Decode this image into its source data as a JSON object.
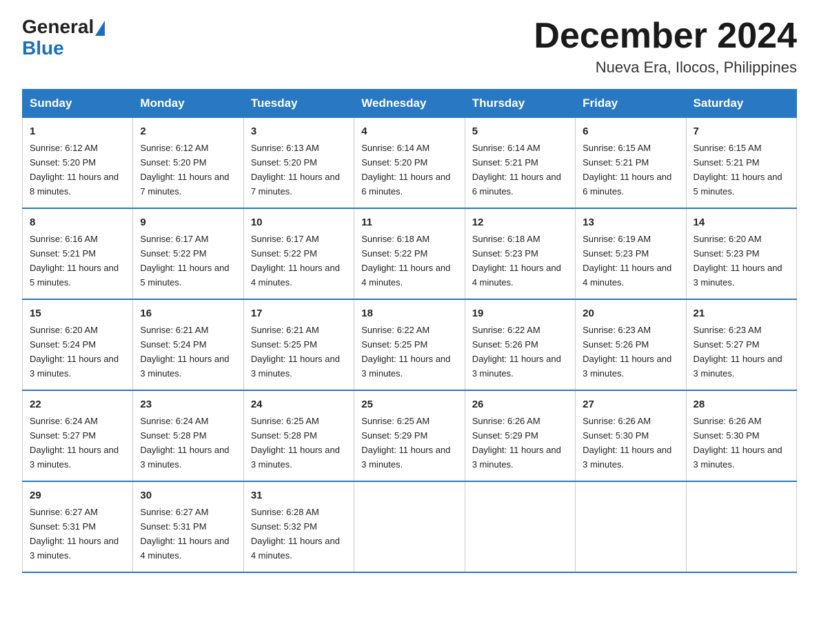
{
  "header": {
    "title": "December 2024",
    "subtitle": "Nueva Era, Ilocos, Philippines",
    "logo_general": "General",
    "logo_blue": "Blue"
  },
  "days_of_week": [
    "Sunday",
    "Monday",
    "Tuesday",
    "Wednesday",
    "Thursday",
    "Friday",
    "Saturday"
  ],
  "weeks": [
    [
      {
        "day": "1",
        "sunrise": "Sunrise: 6:12 AM",
        "sunset": "Sunset: 5:20 PM",
        "daylight": "Daylight: 11 hours and 8 minutes."
      },
      {
        "day": "2",
        "sunrise": "Sunrise: 6:12 AM",
        "sunset": "Sunset: 5:20 PM",
        "daylight": "Daylight: 11 hours and 7 minutes."
      },
      {
        "day": "3",
        "sunrise": "Sunrise: 6:13 AM",
        "sunset": "Sunset: 5:20 PM",
        "daylight": "Daylight: 11 hours and 7 minutes."
      },
      {
        "day": "4",
        "sunrise": "Sunrise: 6:14 AM",
        "sunset": "Sunset: 5:20 PM",
        "daylight": "Daylight: 11 hours and 6 minutes."
      },
      {
        "day": "5",
        "sunrise": "Sunrise: 6:14 AM",
        "sunset": "Sunset: 5:21 PM",
        "daylight": "Daylight: 11 hours and 6 minutes."
      },
      {
        "day": "6",
        "sunrise": "Sunrise: 6:15 AM",
        "sunset": "Sunset: 5:21 PM",
        "daylight": "Daylight: 11 hours and 6 minutes."
      },
      {
        "day": "7",
        "sunrise": "Sunrise: 6:15 AM",
        "sunset": "Sunset: 5:21 PM",
        "daylight": "Daylight: 11 hours and 5 minutes."
      }
    ],
    [
      {
        "day": "8",
        "sunrise": "Sunrise: 6:16 AM",
        "sunset": "Sunset: 5:21 PM",
        "daylight": "Daylight: 11 hours and 5 minutes."
      },
      {
        "day": "9",
        "sunrise": "Sunrise: 6:17 AM",
        "sunset": "Sunset: 5:22 PM",
        "daylight": "Daylight: 11 hours and 5 minutes."
      },
      {
        "day": "10",
        "sunrise": "Sunrise: 6:17 AM",
        "sunset": "Sunset: 5:22 PM",
        "daylight": "Daylight: 11 hours and 4 minutes."
      },
      {
        "day": "11",
        "sunrise": "Sunrise: 6:18 AM",
        "sunset": "Sunset: 5:22 PM",
        "daylight": "Daylight: 11 hours and 4 minutes."
      },
      {
        "day": "12",
        "sunrise": "Sunrise: 6:18 AM",
        "sunset": "Sunset: 5:23 PM",
        "daylight": "Daylight: 11 hours and 4 minutes."
      },
      {
        "day": "13",
        "sunrise": "Sunrise: 6:19 AM",
        "sunset": "Sunset: 5:23 PM",
        "daylight": "Daylight: 11 hours and 4 minutes."
      },
      {
        "day": "14",
        "sunrise": "Sunrise: 6:20 AM",
        "sunset": "Sunset: 5:23 PM",
        "daylight": "Daylight: 11 hours and 3 minutes."
      }
    ],
    [
      {
        "day": "15",
        "sunrise": "Sunrise: 6:20 AM",
        "sunset": "Sunset: 5:24 PM",
        "daylight": "Daylight: 11 hours and 3 minutes."
      },
      {
        "day": "16",
        "sunrise": "Sunrise: 6:21 AM",
        "sunset": "Sunset: 5:24 PM",
        "daylight": "Daylight: 11 hours and 3 minutes."
      },
      {
        "day": "17",
        "sunrise": "Sunrise: 6:21 AM",
        "sunset": "Sunset: 5:25 PM",
        "daylight": "Daylight: 11 hours and 3 minutes."
      },
      {
        "day": "18",
        "sunrise": "Sunrise: 6:22 AM",
        "sunset": "Sunset: 5:25 PM",
        "daylight": "Daylight: 11 hours and 3 minutes."
      },
      {
        "day": "19",
        "sunrise": "Sunrise: 6:22 AM",
        "sunset": "Sunset: 5:26 PM",
        "daylight": "Daylight: 11 hours and 3 minutes."
      },
      {
        "day": "20",
        "sunrise": "Sunrise: 6:23 AM",
        "sunset": "Sunset: 5:26 PM",
        "daylight": "Daylight: 11 hours and 3 minutes."
      },
      {
        "day": "21",
        "sunrise": "Sunrise: 6:23 AM",
        "sunset": "Sunset: 5:27 PM",
        "daylight": "Daylight: 11 hours and 3 minutes."
      }
    ],
    [
      {
        "day": "22",
        "sunrise": "Sunrise: 6:24 AM",
        "sunset": "Sunset: 5:27 PM",
        "daylight": "Daylight: 11 hours and 3 minutes."
      },
      {
        "day": "23",
        "sunrise": "Sunrise: 6:24 AM",
        "sunset": "Sunset: 5:28 PM",
        "daylight": "Daylight: 11 hours and 3 minutes."
      },
      {
        "day": "24",
        "sunrise": "Sunrise: 6:25 AM",
        "sunset": "Sunset: 5:28 PM",
        "daylight": "Daylight: 11 hours and 3 minutes."
      },
      {
        "day": "25",
        "sunrise": "Sunrise: 6:25 AM",
        "sunset": "Sunset: 5:29 PM",
        "daylight": "Daylight: 11 hours and 3 minutes."
      },
      {
        "day": "26",
        "sunrise": "Sunrise: 6:26 AM",
        "sunset": "Sunset: 5:29 PM",
        "daylight": "Daylight: 11 hours and 3 minutes."
      },
      {
        "day": "27",
        "sunrise": "Sunrise: 6:26 AM",
        "sunset": "Sunset: 5:30 PM",
        "daylight": "Daylight: 11 hours and 3 minutes."
      },
      {
        "day": "28",
        "sunrise": "Sunrise: 6:26 AM",
        "sunset": "Sunset: 5:30 PM",
        "daylight": "Daylight: 11 hours and 3 minutes."
      }
    ],
    [
      {
        "day": "29",
        "sunrise": "Sunrise: 6:27 AM",
        "sunset": "Sunset: 5:31 PM",
        "daylight": "Daylight: 11 hours and 3 minutes."
      },
      {
        "day": "30",
        "sunrise": "Sunrise: 6:27 AM",
        "sunset": "Sunset: 5:31 PM",
        "daylight": "Daylight: 11 hours and 4 minutes."
      },
      {
        "day": "31",
        "sunrise": "Sunrise: 6:28 AM",
        "sunset": "Sunset: 5:32 PM",
        "daylight": "Daylight: 11 hours and 4 minutes."
      },
      {
        "day": "",
        "sunrise": "",
        "sunset": "",
        "daylight": ""
      },
      {
        "day": "",
        "sunrise": "",
        "sunset": "",
        "daylight": ""
      },
      {
        "day": "",
        "sunrise": "",
        "sunset": "",
        "daylight": ""
      },
      {
        "day": "",
        "sunrise": "",
        "sunset": "",
        "daylight": ""
      }
    ]
  ]
}
